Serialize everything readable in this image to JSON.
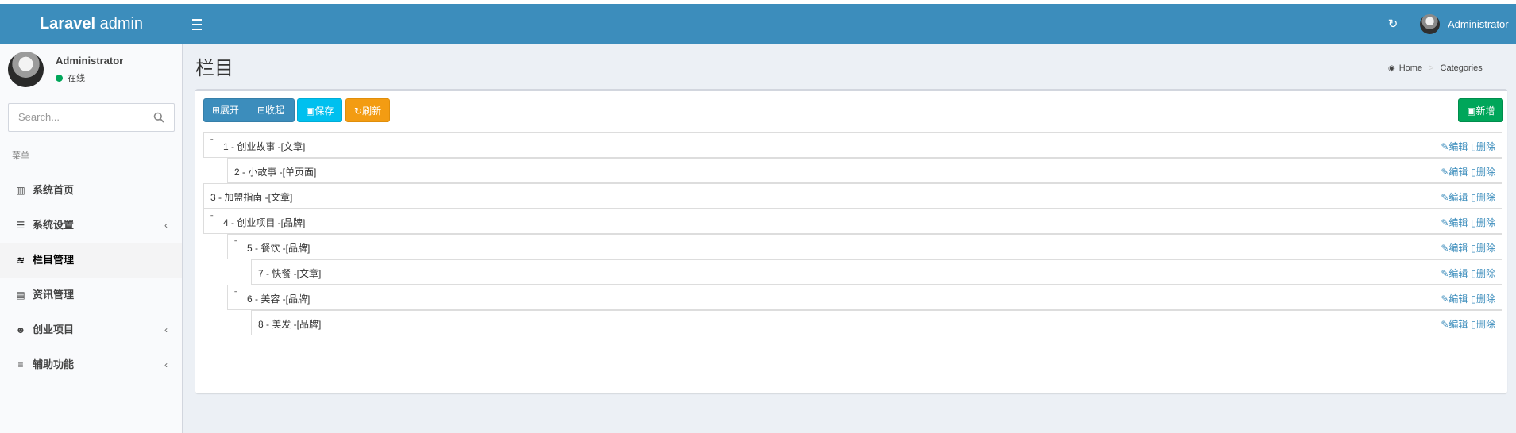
{
  "header": {
    "brand_bold": "Laravel",
    "brand_light": " admin",
    "user_name": "Administrator"
  },
  "sidebar": {
    "user_name": "Administrator",
    "status": "在线",
    "search_placeholder": "Search...",
    "menu_header": "菜单",
    "items": [
      {
        "label": "系统首页",
        "icon": "bar-chart-icon",
        "has_children": false
      },
      {
        "label": "系统设置",
        "icon": "server-icon",
        "has_children": true
      },
      {
        "label": "栏目管理",
        "icon": "database-icon",
        "has_children": false,
        "active": true
      },
      {
        "label": "资讯管理",
        "icon": "book-icon",
        "has_children": false
      },
      {
        "label": "创业项目",
        "icon": "users-icon",
        "has_children": true
      },
      {
        "label": "辅助功能",
        "icon": "align-center-icon",
        "has_children": true
      }
    ]
  },
  "page": {
    "title": "栏目",
    "breadcrumb_home": "Home",
    "breadcrumb_current": "Categories"
  },
  "toolbar": {
    "expand": "⊞展开",
    "collapse": "⊟收起",
    "save": "保存",
    "refresh": "刷新",
    "new": "新增"
  },
  "actions": {
    "edit": "编辑",
    "delete": "删除"
  },
  "tree": [
    {
      "label": "1 - 创业故事 -[文章]",
      "depth": 0,
      "has_children": true
    },
    {
      "label": "2 - 小故事 -[单页面]",
      "depth": 1,
      "has_children": false
    },
    {
      "label": "3 - 加盟指南 -[文章]",
      "depth": 0,
      "has_children": false
    },
    {
      "label": "4 - 创业项目 -[品牌]",
      "depth": 0,
      "has_children": true
    },
    {
      "label": "5 - 餐饮 -[品牌]",
      "depth": 1,
      "has_children": true
    },
    {
      "label": "7 - 快餐 -[文章]",
      "depth": 2,
      "has_children": false
    },
    {
      "label": "6 - 美容 -[品牌]",
      "depth": 1,
      "has_children": true
    },
    {
      "label": "8 - 美发 -[品牌]",
      "depth": 2,
      "has_children": false
    }
  ],
  "colors": {
    "header": "#3c8dbc",
    "save": "#00c0ef",
    "refresh": "#f39c12",
    "new": "#00a65a",
    "status": "#00a65a"
  }
}
